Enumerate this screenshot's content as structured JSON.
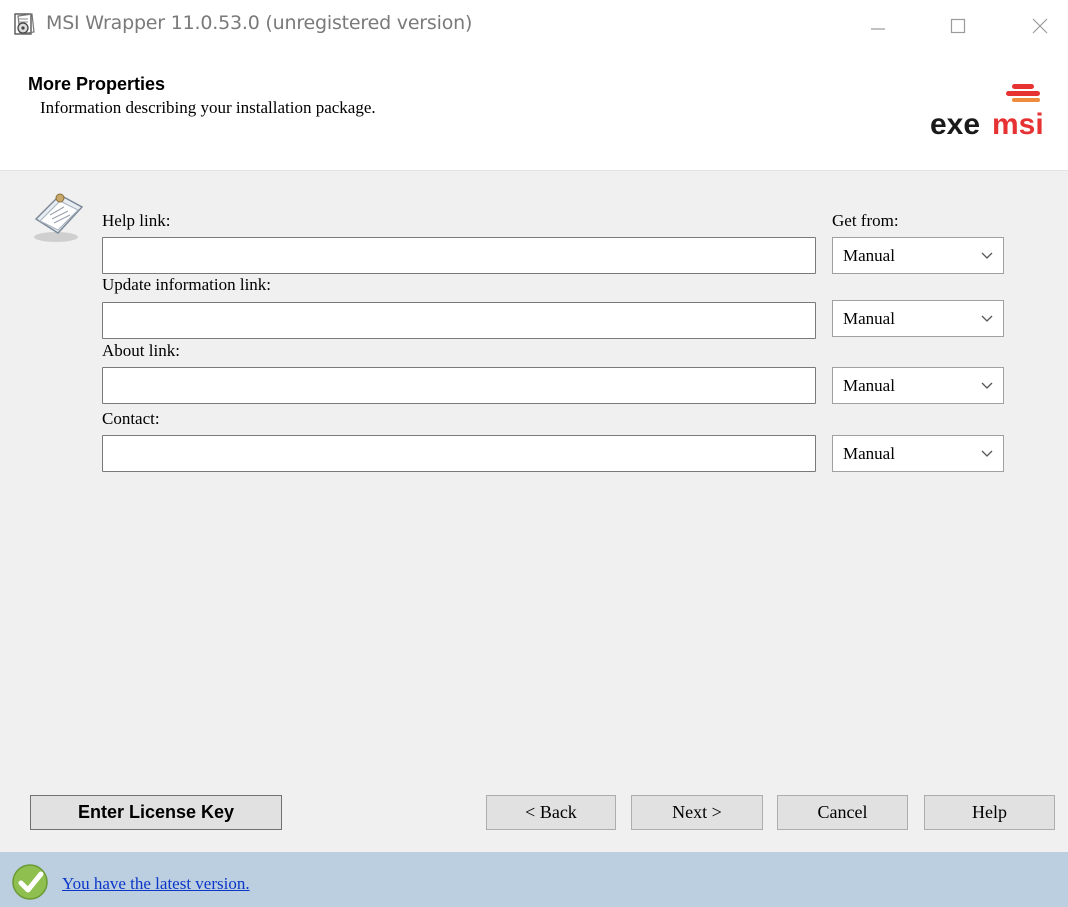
{
  "window": {
    "title": "MSI Wrapper 11.0.53.0 (unregistered version)",
    "minimize_icon": "minimize-icon",
    "maximize_icon": "maximize-icon",
    "close_icon": "close-icon"
  },
  "header": {
    "title": "More Properties",
    "subtitle": "Information describing your installation package.",
    "logo": {
      "part1": "exe",
      "part2": "msi",
      "colors": {
        "exe": "#1a1a1a",
        "msi": "#e63232"
      }
    }
  },
  "form": {
    "get_from_label": "Get from:",
    "fields": [
      {
        "label": "Help link:",
        "value": "",
        "source": "Manual"
      },
      {
        "label": "Update information link:",
        "value": "",
        "source": "Manual"
      },
      {
        "label": "About link:",
        "value": "",
        "source": "Manual"
      },
      {
        "label": "Contact:",
        "value": "",
        "source": "Manual"
      }
    ]
  },
  "buttons": {
    "license": "Enter License Key",
    "back": "< Back",
    "next": "Next >",
    "cancel": "Cancel",
    "help": "Help"
  },
  "status": {
    "message": "You have the latest version.",
    "icon": "check-icon"
  }
}
